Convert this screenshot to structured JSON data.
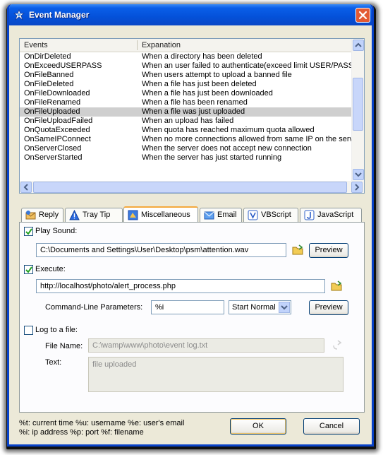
{
  "window": {
    "title": "Event Manager"
  },
  "events_list": {
    "col_events": "Events",
    "col_explanation": "Expanation",
    "rows": [
      {
        "event": "OnDirDeleted",
        "explanation": "When a directory has been deleted"
      },
      {
        "event": "OnExceedUSERPASS",
        "explanation": "When an user failed to authenticate(exceed limit USER/PASS"
      },
      {
        "event": "OnFileBanned",
        "explanation": "When users attempt to upload a banned file"
      },
      {
        "event": "OnFileDeleted",
        "explanation": "When a file has just been deleted"
      },
      {
        "event": "OnFileDownloaded",
        "explanation": "When a file has just been downloaded"
      },
      {
        "event": "OnFileRenamed",
        "explanation": "When a file has been renamed"
      },
      {
        "event": "OnFileUploaded",
        "explanation": "When a file was just uploaded"
      },
      {
        "event": "OnFileUploadFailed",
        "explanation": "When an upload has failed"
      },
      {
        "event": "OnQuotaExceeded",
        "explanation": "When quota has reached maximum quota allowed"
      },
      {
        "event": "OnSameIPConnect",
        "explanation": "When no more connections allowed from same IP on the server"
      },
      {
        "event": "OnServerClosed",
        "explanation": "When the server does not accept new connection"
      },
      {
        "event": "OnServerStarted",
        "explanation": "When the server has just started running"
      }
    ],
    "selected_index": 6
  },
  "tabs": [
    {
      "label": "Reply",
      "icon": "envelope-icon"
    },
    {
      "label": "Tray Tip",
      "icon": "warning-icon"
    },
    {
      "label": "Miscellaneous",
      "icon": "misc-icon"
    },
    {
      "label": "Email",
      "icon": "email-icon"
    },
    {
      "label": "VBScript",
      "icon": "vbscript-icon"
    },
    {
      "label": "JavaScript",
      "icon": "javascript-icon"
    }
  ],
  "active_tab": "Miscellaneous",
  "play_sound": {
    "label": "Play Sound:",
    "checked": true,
    "path": "C:\\Documents and Settings\\User\\Desktop\\psm\\attention.wav",
    "preview": "Preview"
  },
  "execute": {
    "label": "Execute:",
    "checked": true,
    "path": "http://localhost/photo/alert_process.php",
    "params_label": "Command-Line Parameters:",
    "params_value": "%i",
    "mode": "Start Normal",
    "preview": "Preview"
  },
  "log": {
    "label": "Log to a file:",
    "checked": false,
    "file_label": "File Name:",
    "file_value": "C:\\wamp\\www\\photo\\event log.txt",
    "text_label": "Text:",
    "text_value": "file uploaded"
  },
  "legend": {
    "line1": "%t: current time  %u: username %e: user's email",
    "line2": "%i: ip address  %p: port  %f: filename"
  },
  "buttons": {
    "ok": "OK",
    "cancel": "Cancel"
  },
  "colors": {
    "title_bar": "#0a5ee8",
    "close": "#e35a33",
    "active_tab_accent": "#f4a93e",
    "selection": "#cfcfcf"
  }
}
